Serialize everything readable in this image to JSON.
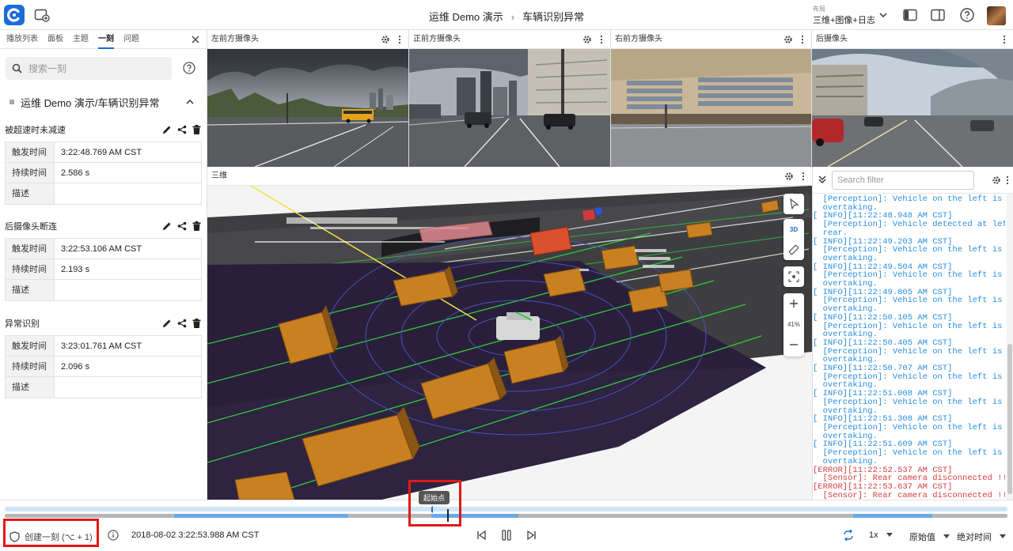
{
  "header": {
    "breadcrumb": [
      "运维 Demo 演示",
      "车辆识别异常"
    ],
    "layout_label": "布局",
    "layout_value": "三维+图像+日志"
  },
  "sidebar": {
    "tabs": [
      "播放列表",
      "面板",
      "主题",
      "一刻",
      "问题"
    ],
    "active_tab": "一刻",
    "search_placeholder": "搜索一刻",
    "group_title": "运维 Demo 演示/车辆识别异常",
    "moments": [
      {
        "title": "被超速时未减速",
        "rows": [
          [
            "触发时间",
            "3:22:48.769 AM CST"
          ],
          [
            "持续时间",
            "2.586 s"
          ],
          [
            "描述",
            ""
          ]
        ]
      },
      {
        "title": "后摄像头断连",
        "rows": [
          [
            "触发时间",
            "3:22:53.106 AM CST"
          ],
          [
            "持续时间",
            "2.193 s"
          ],
          [
            "描述",
            ""
          ]
        ]
      },
      {
        "title": "异常识别",
        "rows": [
          [
            "触发时间",
            "3:23:01.761 AM CST"
          ],
          [
            "持续时间",
            "2.096 s"
          ],
          [
            "描述",
            ""
          ]
        ]
      }
    ]
  },
  "cameras": [
    "左前方摄像头",
    "正前方摄像头",
    "右前方摄像头",
    "后摄像头"
  ],
  "three_d": {
    "title": "三维",
    "mode": "3D",
    "zoom": "41%"
  },
  "log": {
    "filter_placeholder": "Search filter",
    "lines": [
      {
        "t": "  [Perception]: Vehicle on the left is",
        "level": "info"
      },
      {
        "t": "  overtaking.",
        "level": "info"
      },
      {
        "t": "[ INFO][11:22:48.948 AM CST]",
        "level": "info"
      },
      {
        "t": "  [Perception]: Vehicle detected at left",
        "level": "info"
      },
      {
        "t": "  rear.",
        "level": "info"
      },
      {
        "t": "[ INFO][11:22:49.203 AM CST]",
        "level": "info"
      },
      {
        "t": "  [Perception]: Vehicle on the left is",
        "level": "info"
      },
      {
        "t": "  overtaking.",
        "level": "info"
      },
      {
        "t": "[ INFO][11:22:49.504 AM CST]",
        "level": "info"
      },
      {
        "t": "  [Perception]: Vehicle on the left is",
        "level": "info"
      },
      {
        "t": "  overtaking.",
        "level": "info"
      },
      {
        "t": "[ INFO][11:22:49.805 AM CST]",
        "level": "info"
      },
      {
        "t": "  [Perception]: Vehicle on the left is",
        "level": "info"
      },
      {
        "t": "  overtaking.",
        "level": "info"
      },
      {
        "t": "[ INFO][11:22:50.105 AM CST]",
        "level": "info"
      },
      {
        "t": "  [Perception]: Vehicle on the left is",
        "level": "info"
      },
      {
        "t": "  overtaking.",
        "level": "info"
      },
      {
        "t": "[ INFO][11:22:50.405 AM CST]",
        "level": "info"
      },
      {
        "t": "  [Perception]: Vehicle on the left is",
        "level": "info"
      },
      {
        "t": "  overtaking.",
        "level": "info"
      },
      {
        "t": "[ INFO][11:22:50.707 AM CST]",
        "level": "info"
      },
      {
        "t": "  [Perception]: Vehicle on the left is",
        "level": "info"
      },
      {
        "t": "  overtaking.",
        "level": "info"
      },
      {
        "t": "[ INFO][11:22:51.008 AM CST]",
        "level": "info"
      },
      {
        "t": "  [Perception]: Vehicle on the left is",
        "level": "info"
      },
      {
        "t": "  overtaking.",
        "level": "info"
      },
      {
        "t": "[ INFO][11:22:51.308 AM CST]",
        "level": "info"
      },
      {
        "t": "  [Perception]: Vehicle on the left is",
        "level": "info"
      },
      {
        "t": "  overtaking.",
        "level": "info"
      },
      {
        "t": "[ INFO][11:22:51.609 AM CST]",
        "level": "info"
      },
      {
        "t": "  [Perception]: Vehicle on the left is",
        "level": "info"
      },
      {
        "t": "  overtaking.",
        "level": "info"
      },
      {
        "t": "[ERROR][11:22:52.537 AM CST]",
        "level": "error"
      },
      {
        "t": "  [Sensor]: Rear camera disconnected !!!",
        "level": "error"
      },
      {
        "t": "[ERROR][11:22:53.637 AM CST]",
        "level": "error"
      },
      {
        "t": "  [Sensor]: Rear camera disconnected !!!",
        "level": "error"
      }
    ]
  },
  "timeline": {
    "start_point_label": "起始点",
    "create_moment": "创建一刻 (⌥ + 1)",
    "timestamp": "2018-08-02 3:22:53.988 AM CST",
    "speed": "1x",
    "value_mode": "原始值",
    "time_mode": "绝对时间"
  },
  "colors": {
    "accent": "#1b6cd8",
    "log_info": "#2a8ee0",
    "log_error": "#d63d3d",
    "highlight": "#e01818"
  }
}
